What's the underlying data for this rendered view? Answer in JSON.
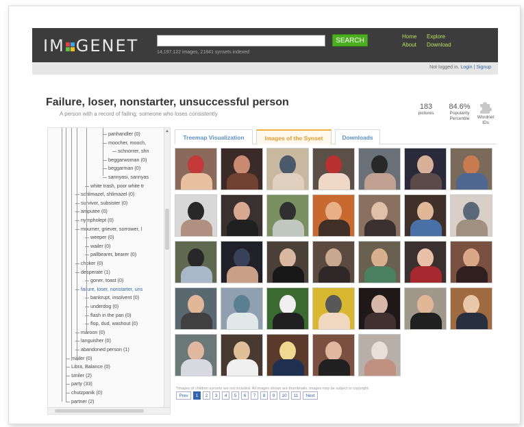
{
  "header": {
    "logo_left": "IM",
    "logo_right": "GENET",
    "search_button": "SEARCH",
    "search_stats": "14,197,122 images, 21841 synsets indexed",
    "nav": {
      "home": "Home",
      "about": "About",
      "explore": "Explore",
      "download": "Download"
    }
  },
  "login": {
    "status": "Not logged in.",
    "login": "Login",
    "separator": "|",
    "signup": "Signup"
  },
  "synset": {
    "title": "Failure, loser, nonstarter, unsuccessful person",
    "gloss": "A person with a record of failing; someone who loses consistently",
    "pictures_count": "183",
    "pictures_label": "pictures",
    "popularity_value": "84.6%",
    "popularity_label_1": "Popularity",
    "popularity_label_2": "Percentile",
    "wordnet_label_1": "Wordnet",
    "wordnet_label_2": "IDs"
  },
  "tree": [
    "panhandler (0)",
    "moocher, mooch,",
    "schnorrer, shn",
    "beggarwoman (0)",
    "beggarman (0)",
    "sannyasi, sannyas",
    "white trash, poor white tr",
    "schlimazel, shlimazel (0)",
    "survivor, subsister (0)",
    "amputee (0)",
    "nympholept (0)",
    "mourner, griever, sorrower, l",
    "weeper (0)",
    "wailer (0)",
    "pallbearer, bearer (0)",
    "choker (0)",
    "desperate (1)",
    "goner, toast (0)",
    "failure, loser, nonstarter, uns",
    "bankrupt, insolvent (0)",
    "underdog (0)",
    "flash in the pan (0)",
    "flop, dud, washout (0)",
    "maroon (0)",
    "languisher (0)",
    "abandoned person (1)",
    "mailer (0)",
    "Libra, Balance (0)",
    "smiler (2)",
    "party (33)",
    "chutzpanik (0)",
    "partner (2)"
  ],
  "tabs": [
    "Treemap Visualization",
    "Images of the Synset",
    "Downloads"
  ],
  "images": [
    {
      "bg": "#8a6a5a",
      "fg": "#c23a3a",
      "accent": "#e8c0a0"
    },
    {
      "bg": "#3a2a28",
      "fg": "#c88a70",
      "accent": "#704030"
    },
    {
      "bg": "#c8b8a0",
      "fg": "#4a5a6a",
      "accent": "#e0d0c0"
    },
    {
      "bg": "#5a5048",
      "fg": "#b83030",
      "accent": "#f0d8c8"
    },
    {
      "bg": "#6a7078",
      "fg": "#282828",
      "accent": "#c0a090"
    },
    {
      "bg": "#2a2a3a",
      "fg": "#d8b098",
      "accent": "#5a4a4a"
    },
    {
      "bg": "#7a6a5a",
      "fg": "#c87a50",
      "accent": "#506890"
    },
    {
      "bg": "#d8d8d8",
      "fg": "#282828",
      "accent": "#b09080"
    },
    {
      "bg": "#3a3030",
      "fg": "#d8a890",
      "accent": "#202020"
    },
    {
      "bg": "#7a9060",
      "fg": "#303030",
      "accent": "#c0c8c0"
    },
    {
      "bg": "#c86a30",
      "fg": "#e8b088",
      "accent": "#403028"
    },
    {
      "bg": "#8a7060",
      "fg": "#e0c0a8",
      "accent": "#3a3030"
    },
    {
      "bg": "#40302a",
      "fg": "#e0b898",
      "accent": "#4a70a8"
    },
    {
      "bg": "#d8d0c8",
      "fg": "#5a6878",
      "accent": "#a09080"
    },
    {
      "bg": "#606850",
      "fg": "#282828",
      "accent": "#a8b8c8"
    },
    {
      "bg": "#202028",
      "fg": "#3a4058",
      "accent": "#c8a088"
    },
    {
      "bg": "#4a4038",
      "fg": "#d8b8a0",
      "accent": "#181818"
    },
    {
      "bg": "#5a4a40",
      "fg": "#c8a890",
      "accent": "#302828"
    },
    {
      "bg": "#6a6050",
      "fg": "#d8b090",
      "accent": "#4a8060"
    },
    {
      "bg": "#3a3030",
      "fg": "#e8c0a8",
      "accent": "#a82830"
    },
    {
      "bg": "#7a5040",
      "fg": "#d8a888",
      "accent": "#302020"
    },
    {
      "bg": "#5a6870",
      "fg": "#e0b898",
      "accent": "#404040"
    },
    {
      "bg": "#90a0b0",
      "fg": "#5a8090",
      "accent": "#e0e8e8"
    },
    {
      "bg": "#3a6a30",
      "fg": "#f0f0f0",
      "accent": "#202020"
    },
    {
      "bg": "#d8b830",
      "fg": "#585858",
      "accent": "#f0d8c0"
    },
    {
      "bg": "#201818",
      "fg": "#d8b8a8",
      "accent": "#403030"
    },
    {
      "bg": "#a0988a",
      "fg": "#e0b898",
      "accent": "#202020"
    },
    {
      "bg": "#a06a40",
      "fg": "#e8c8a8",
      "accent": "#283040"
    },
    {
      "bg": "#6a7878",
      "fg": "#e0b8a0",
      "accent": "#d8d8e0"
    },
    {
      "bg": "#483a30",
      "fg": "#e0c098",
      "accent": "#f0f0f0"
    },
    {
      "bg": "#5a3a2a",
      "fg": "#f0d890",
      "accent": "#203050"
    },
    {
      "bg": "#7a5040",
      "fg": "#e0b8a0",
      "accent": "#202020"
    },
    {
      "bg": "#b8b0a8",
      "fg": "#e8e0d8",
      "accent": "#c09080"
    }
  ],
  "note": "*Images of children synsets are not included. All images shown are thumbnails. Images may be subject to copyright.",
  "pager": {
    "prev": "Prev",
    "pages": [
      "1",
      "2",
      "3",
      "4",
      "5",
      "6",
      "7",
      "8",
      "9",
      "10",
      "11"
    ],
    "next": "Next",
    "current": "1"
  },
  "colors": {
    "header_bg": "#3c3c3c",
    "search_green": "#4caf20",
    "nav_green": "#b8e060",
    "tab_active": "#e39a2a",
    "link_blue": "#3366aa"
  }
}
